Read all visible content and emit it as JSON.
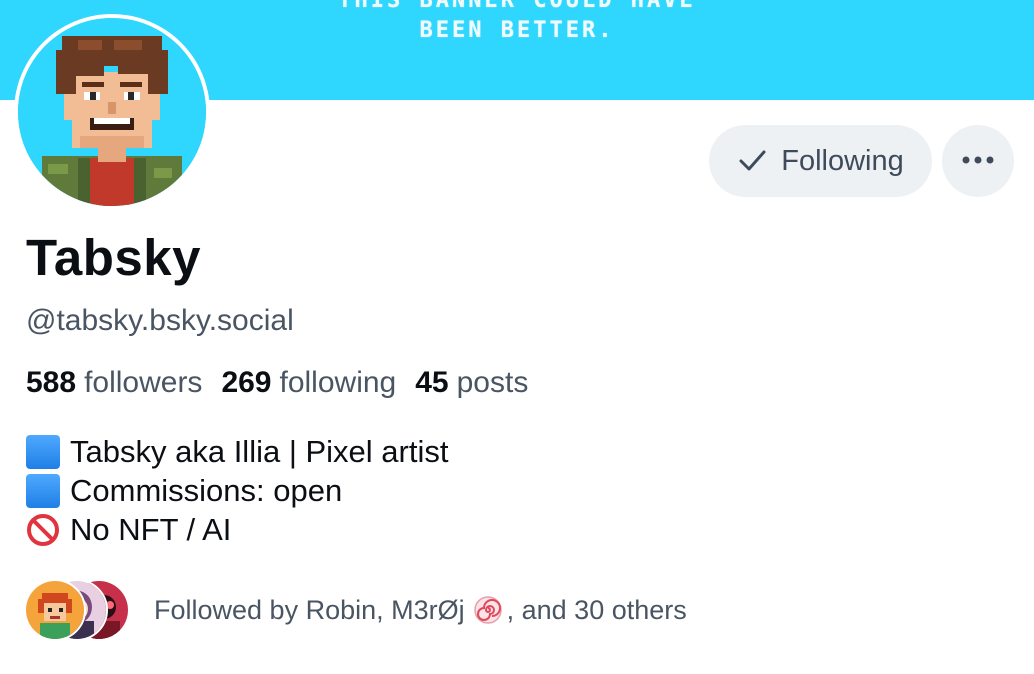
{
  "banner": {
    "line1": "THIS BANNER COULD HAVE",
    "line2": "BEEN BETTER.",
    "color": "#2fd6fd"
  },
  "avatar": {
    "icon": "pixel-art-portrait"
  },
  "actions": {
    "following_label": "Following",
    "following_icon": "check-icon",
    "more_icon": "ellipsis-icon"
  },
  "profile": {
    "display_name": "Tabsky",
    "handle": "@tabsky.bsky.social"
  },
  "stats": {
    "followers_count": "588",
    "followers_label": "followers",
    "following_count": "269",
    "following_label": "following",
    "posts_count": "45",
    "posts_label": "posts"
  },
  "bio": {
    "line1": "Tabsky aka Illia | Pixel artist",
    "line2": "Commissions: open",
    "line3": "No NFT / AI",
    "line1_icon": "blue-square-icon",
    "line2_icon": "blue-square-icon",
    "line3_icon": "prohibited-icon"
  },
  "followed_by": {
    "prefix": "Followed by Robin, M3rØj",
    "suffix": ", and 30 others",
    "emoji_icon": "spiral-candy-icon"
  },
  "colors": {
    "accent_banner": "#2fd6fd",
    "button_bg": "#eef1f4",
    "muted_text": "#4a5563",
    "primary_text": "#0b0f14"
  }
}
